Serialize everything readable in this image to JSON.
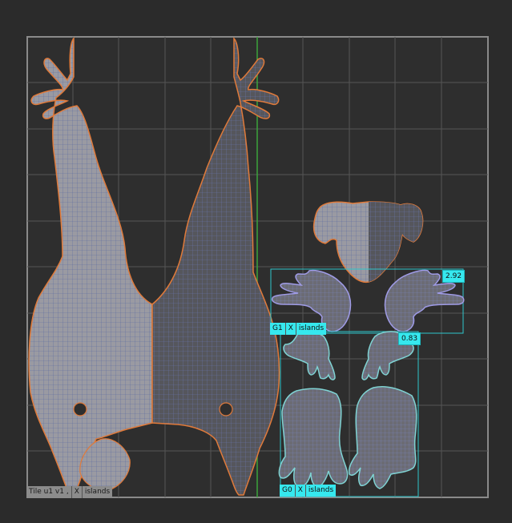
{
  "colors": {
    "background": "#2b2b2b",
    "tile_border": "#8a8a8a",
    "grid": "#555555",
    "axis_line": "#3ca33c",
    "shell_fill": "#9a9aa2",
    "shell_fill_dark": "#55565c",
    "shell_outline": "#e07a3a",
    "island_outline": "#9f9be6",
    "selected_outline": "#7fd3d3",
    "group_box": "#2ec6cc",
    "tag_bg": "#36e8ee"
  },
  "groups": [
    {
      "id": "G1",
      "x_label": "X",
      "islands_label": "islands",
      "value": "2.92"
    },
    {
      "id": "G0",
      "x_label": "X",
      "islands_label": "islands",
      "value": "0.83"
    }
  ],
  "tile_status": {
    "tile_label": "Tile u1  v1 ,",
    "x_label": "X",
    "islands_label": "islands"
  },
  "icons": [
    "uv-body-shell",
    "uv-head-shell",
    "uv-hand-shell",
    "uv-foot-shell",
    "uv-leg-shell"
  ]
}
